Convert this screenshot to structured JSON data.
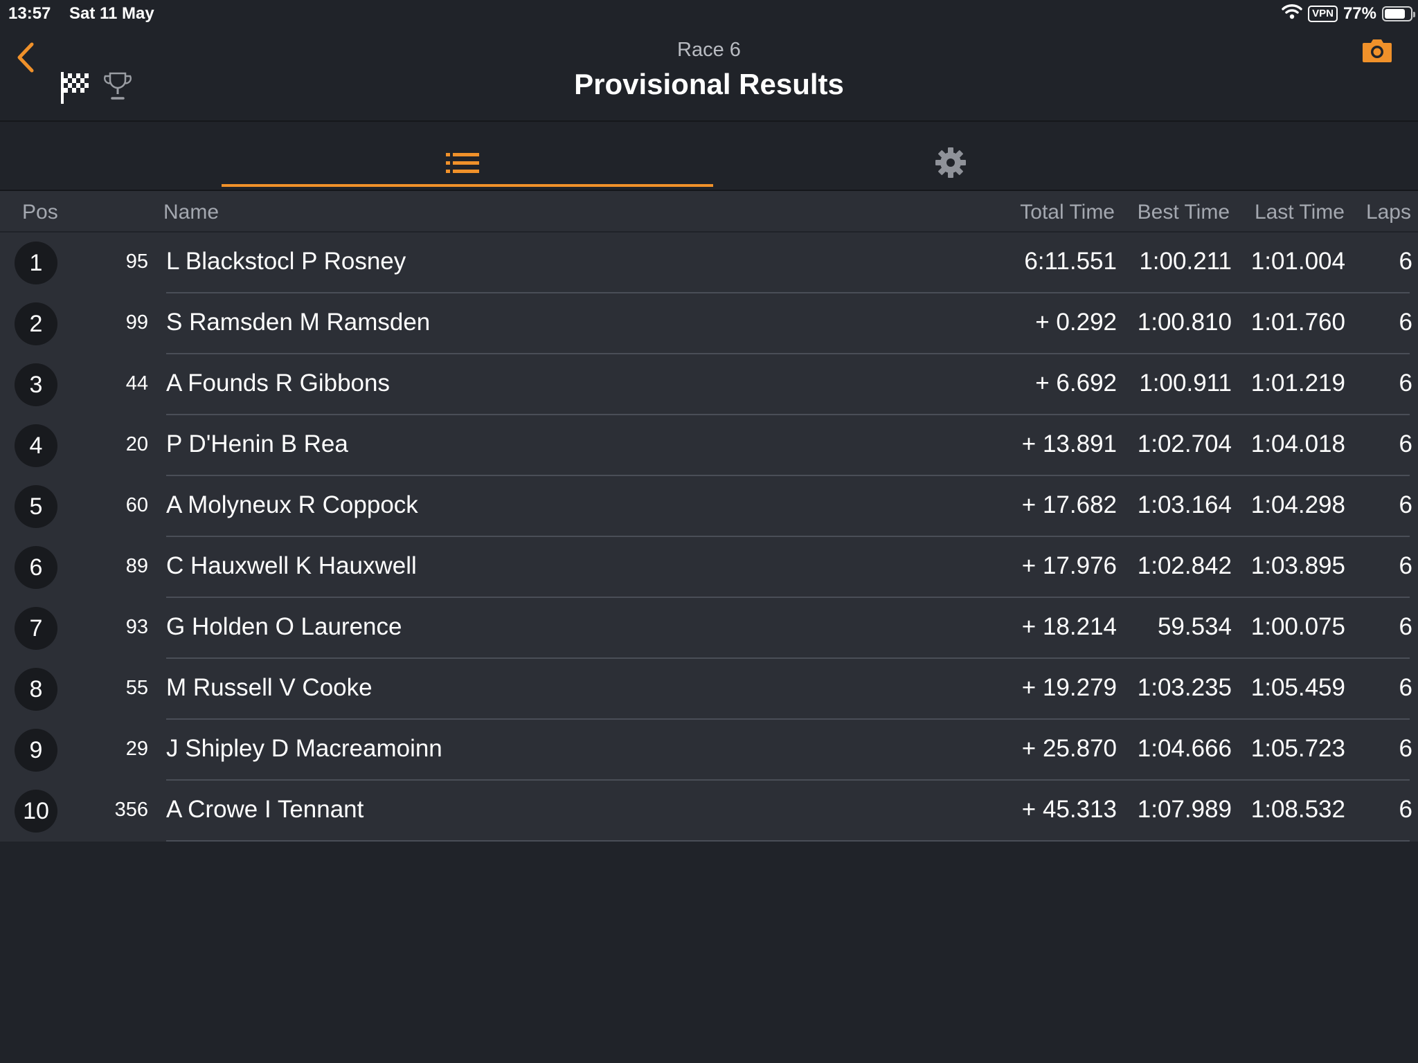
{
  "status_bar": {
    "time": "13:57",
    "date": "Sat 11 May",
    "vpn": "VPN",
    "battery": "77%",
    "battery_level": 0.77,
    "icons": [
      "wifi-icon",
      "battery-icon"
    ]
  },
  "header": {
    "subtitle": "Race 6",
    "title": "Provisional Results",
    "icons": [
      "back-chevron-icon",
      "checkered-flag-icon",
      "trophy-icon",
      "camera-icon"
    ]
  },
  "tabs": {
    "icons": [
      "list-icon",
      "gear-icon"
    ],
    "active": "list"
  },
  "colors": {
    "accent": "#f0912a",
    "background": "#202329",
    "row": "#2c2f36",
    "badge": "#181a1e"
  },
  "table": {
    "columns": {
      "pos": "Pos",
      "name": "Name",
      "total": "Total Time",
      "best": "Best Time",
      "last": "Last Time",
      "laps": "Laps"
    },
    "rows": [
      {
        "pos": "1",
        "num": "95",
        "name": "L Blackstocl P Rosney",
        "total": "6:11.551",
        "best": "1:00.211",
        "last": "1:01.004",
        "laps": "6"
      },
      {
        "pos": "2",
        "num": "99",
        "name": "S Ramsden M Ramsden",
        "total": "+ 0.292",
        "best": "1:00.810",
        "last": "1:01.760",
        "laps": "6"
      },
      {
        "pos": "3",
        "num": "44",
        "name": "A Founds R Gibbons",
        "total": "+ 6.692",
        "best": "1:00.911",
        "last": "1:01.219",
        "laps": "6"
      },
      {
        "pos": "4",
        "num": "20",
        "name": "P D'Henin B Rea",
        "total": "+ 13.891",
        "best": "1:02.704",
        "last": "1:04.018",
        "laps": "6"
      },
      {
        "pos": "5",
        "num": "60",
        "name": "A Molyneux R Coppock",
        "total": "+ 17.682",
        "best": "1:03.164",
        "last": "1:04.298",
        "laps": "6"
      },
      {
        "pos": "6",
        "num": "89",
        "name": "C Hauxwell K Hauxwell",
        "total": "+ 17.976",
        "best": "1:02.842",
        "last": "1:03.895",
        "laps": "6"
      },
      {
        "pos": "7",
        "num": "93",
        "name": "G Holden O Laurence",
        "total": "+ 18.214",
        "best": "59.534",
        "last": "1:00.075",
        "laps": "6"
      },
      {
        "pos": "8",
        "num": "55",
        "name": "M Russell V Cooke",
        "total": "+ 19.279",
        "best": "1:03.235",
        "last": "1:05.459",
        "laps": "6"
      },
      {
        "pos": "9",
        "num": "29",
        "name": "J Shipley D Macreamoinn",
        "total": "+ 25.870",
        "best": "1:04.666",
        "last": "1:05.723",
        "laps": "6"
      },
      {
        "pos": "10",
        "num": "356",
        "name": "A Crowe I Tennant",
        "total": "+ 45.313",
        "best": "1:07.989",
        "last": "1:08.532",
        "laps": "6"
      }
    ]
  }
}
